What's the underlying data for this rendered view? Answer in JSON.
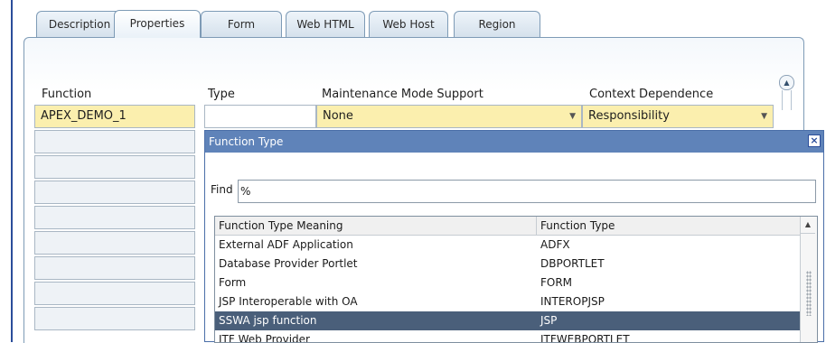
{
  "tabs": [
    "Description",
    "Properties",
    "Form",
    "Web HTML",
    "Web Host",
    "Region"
  ],
  "active_tab": "Properties",
  "form": {
    "function_label": "Function",
    "function_value": "APEX_DEMO_1",
    "type_label": "Type",
    "type_value": "",
    "maintenance_label": "Maintenance Mode Support",
    "maintenance_value": "None",
    "context_label": "Context Dependence",
    "context_value": "Responsibility"
  },
  "dialog": {
    "title": "Function Type",
    "find_label": "Find",
    "find_value": "%",
    "columns": [
      "Function Type Meaning",
      "Function Type"
    ],
    "rows": [
      {
        "meaning": "External ADF Application",
        "type": "ADFX"
      },
      {
        "meaning": "Database Provider Portlet",
        "type": "DBPORTLET"
      },
      {
        "meaning": "Form",
        "type": "FORM"
      },
      {
        "meaning": "JSP Interoperable with OA",
        "type": "INTEROPJSP"
      },
      {
        "meaning": "SSWA jsp function",
        "type": "JSP"
      },
      {
        "meaning": "ITF Web Provider",
        "type": "ITFWEBPORTLET"
      }
    ],
    "selected_index": 4
  },
  "colors": {
    "accent": "#2a4d9a",
    "dialog_title_bg": "#5f83b9",
    "required_field": "#fbefae",
    "selected_row": "#4a5f7a"
  },
  "icons": {
    "dropdown": "chevron-down-icon",
    "close": "close-icon",
    "scroll_up": "scroll-up-icon"
  }
}
